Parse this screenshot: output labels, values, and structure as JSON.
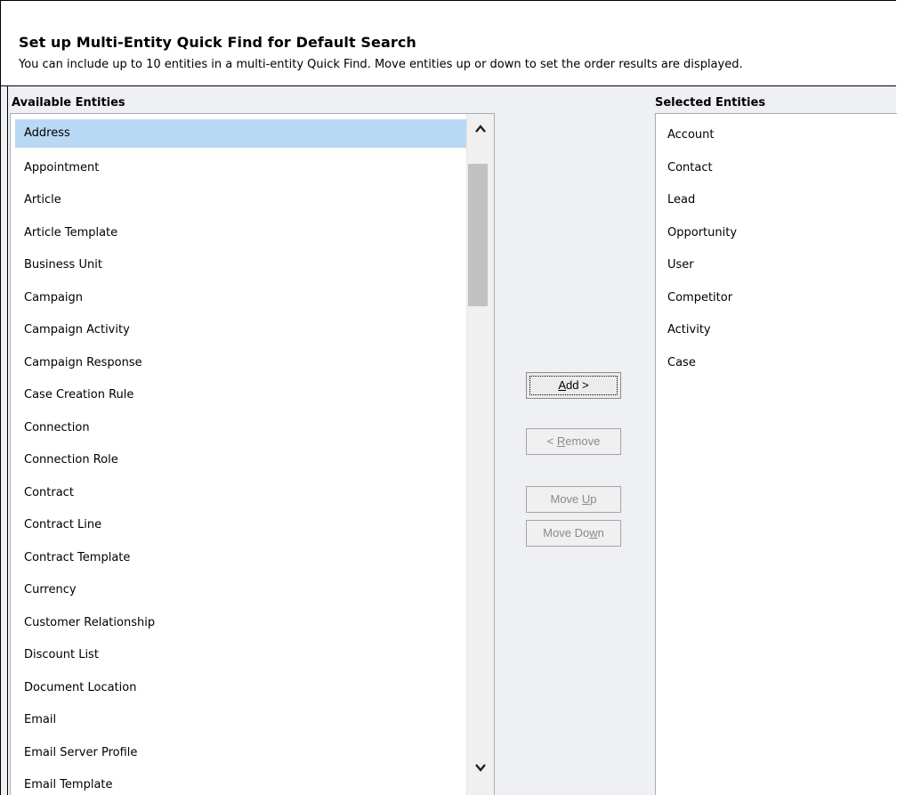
{
  "dialog": {
    "title": "Set up Multi-Entity Quick Find for Default Search",
    "subtitle": "You can include up to 10 entities in a multi-entity Quick Find. Move entities up or down to set the order results are displayed."
  },
  "available": {
    "label": "Available Entities",
    "selected_item": "Address",
    "items": [
      "Address",
      "Appointment",
      "Article",
      "Article Template",
      "Business Unit",
      "Campaign",
      "Campaign Activity",
      "Campaign Response",
      "Case Creation Rule",
      "Connection",
      "Connection Role",
      "Contract",
      "Contract Line",
      "Contract Template",
      "Currency",
      "Customer Relationship",
      "Discount List",
      "Document Location",
      "Email",
      "Email Server Profile",
      "Email Template"
    ]
  },
  "selected": {
    "label": "Selected Entities",
    "items": [
      "Account",
      "Contact",
      "Lead",
      "Opportunity",
      "User",
      "Competitor",
      "Activity",
      "Case"
    ]
  },
  "buttons": {
    "add": {
      "pre": "",
      "accel": "A",
      "post": "dd >"
    },
    "remove": {
      "pre": "< ",
      "accel": "R",
      "post": "emove"
    },
    "move_up": {
      "pre": "Move ",
      "accel": "U",
      "post": "p"
    },
    "move_down": {
      "pre": "Move Do",
      "accel": "w",
      "post": "n"
    }
  },
  "icons": {
    "scroll_up": "chevron-up-icon",
    "scroll_down": "chevron-down-icon"
  },
  "colors": {
    "selection": "#b9d8f4",
    "body_bg": "#eef0f3"
  }
}
